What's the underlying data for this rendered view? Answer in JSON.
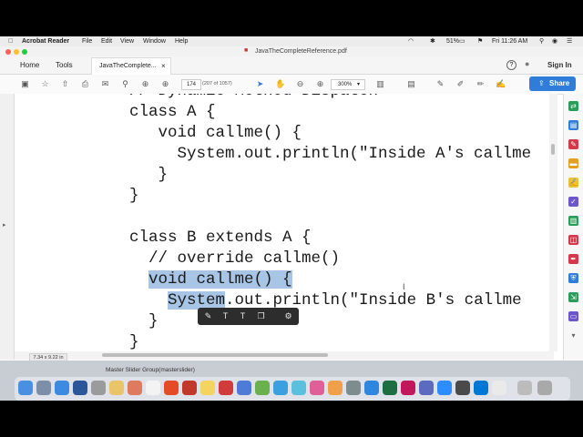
{
  "menubar": {
    "app_name": "Acrobat Reader",
    "items": [
      "File",
      "Edit",
      "View",
      "Window",
      "Help"
    ],
    "battery": "51%",
    "clock": "Fri 11:26 AM"
  },
  "window": {
    "title": "JavaTheCompleteReference.pdf"
  },
  "tabs": {
    "home": "Home",
    "tools": "Tools",
    "document": "JavaTheComplete...",
    "close": "×"
  },
  "account": {
    "sign_in": "Sign In"
  },
  "toolbar": {
    "page_number": "174",
    "page_count": "(207 of 1057)",
    "zoom": "300%",
    "share_label": "Share"
  },
  "code_lines": [
    "// Dynamic Method Dispatch",
    "class A {",
    "   void callme() {",
    "     System.out.println(\"Inside A's callme",
    "   }",
    "}",
    "",
    "class B extends A {",
    "  // override callme()",
    "  void callme() {",
    "    System.out.println(\"Inside B's callme",
    "  }",
    "}"
  ],
  "code_highlight": {
    "line10": "void callme() {",
    "line11_sel": "System",
    "line11_rest": ".out.println(\"Inside B's callme"
  },
  "status": {
    "page_size": "7.34 x 9.22 in"
  },
  "desktop": {
    "window_label": "Master Slider Group(masterslider)"
  },
  "colors": {
    "accent": "#2f7dd8",
    "highlight": "#a9c5e6",
    "float_toolbar": "#2d2d2d"
  }
}
